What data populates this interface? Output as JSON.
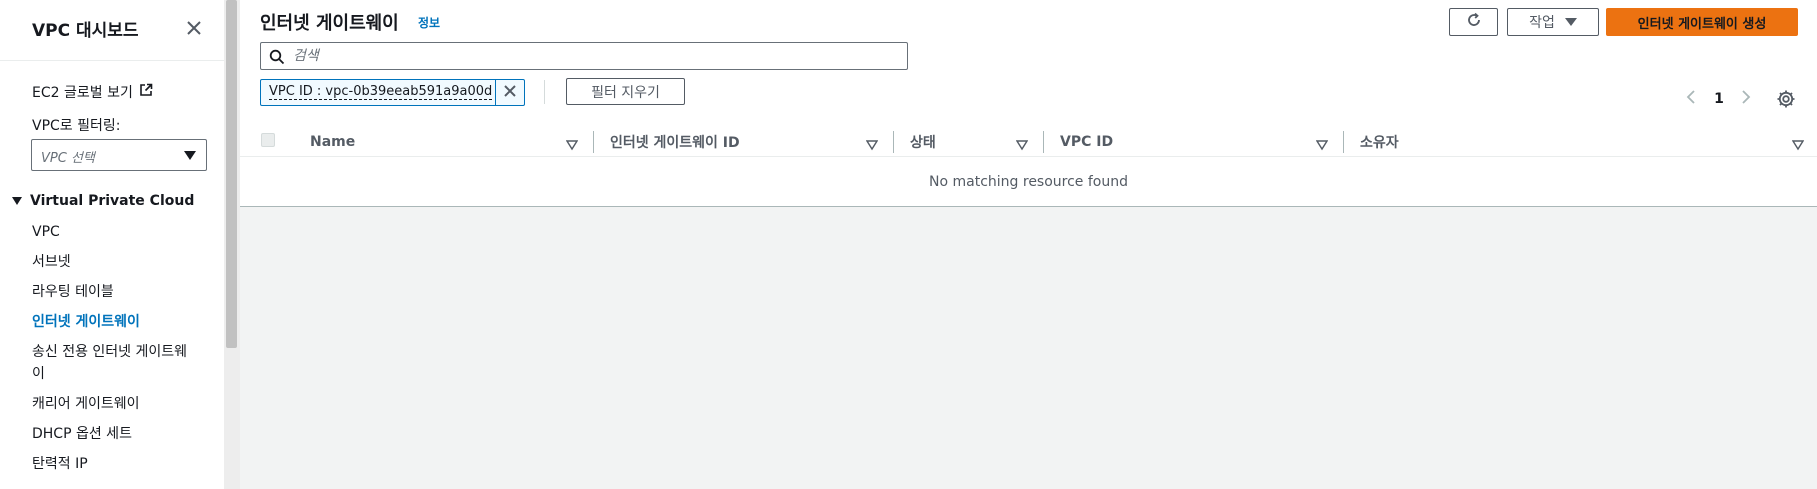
{
  "sidebar": {
    "title": "VPC 대시보드",
    "ec2_link": "EC2 글로벌 보기",
    "filter_label": "VPC로 필터링:",
    "select_placeholder": "VPC 선택",
    "section_title": "Virtual Private Cloud",
    "items": [
      {
        "label": "VPC"
      },
      {
        "label": "서브넷"
      },
      {
        "label": "라우팅 테이블"
      },
      {
        "label": "인터넷 게이트웨이"
      },
      {
        "label": "송신 전용 인터넷 게이트웨이"
      },
      {
        "label": "캐리어 게이트웨이"
      },
      {
        "label": "DHCP 옵션 세트"
      },
      {
        "label": "탄력적 IP"
      }
    ],
    "active_item": "인터넷 게이트웨이"
  },
  "header": {
    "title": "인터넷 게이트웨이",
    "info": "정보",
    "actions_label": "작업",
    "create_label": "인터넷 게이트웨이 생성"
  },
  "search": {
    "placeholder": "검색",
    "value": ""
  },
  "filter_token": {
    "text": "VPC ID : vpc-0b39eeab591a9a00d"
  },
  "clear_filters_label": "필터 지우기",
  "pagination": {
    "current_page": "1"
  },
  "table": {
    "columns": [
      "Name",
      "인터넷 게이트웨이 ID",
      "상태",
      "VPC ID",
      "소유자"
    ],
    "empty_message": "No matching resource found"
  },
  "colors": {
    "primary_button": "#ec7211",
    "link": "#0073bb",
    "active_nav": "#0073bb"
  }
}
